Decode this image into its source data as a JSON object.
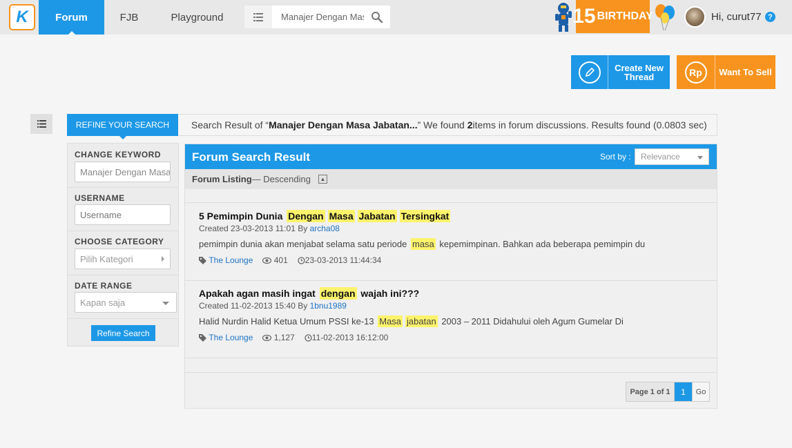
{
  "nav": {
    "logo_text": "K",
    "tabs": [
      {
        "label": "Forum",
        "active": true
      },
      {
        "label": "FJB",
        "active": false
      },
      {
        "label": "Playground",
        "active": false
      }
    ],
    "search": {
      "value": "Manajer Dengan Masa Jabatan"
    },
    "birthday": {
      "number": "15",
      "label": "BIRTHDAY"
    },
    "greeting": "Hi, curut77",
    "help": "?"
  },
  "actions": {
    "create_thread": "Create New Thread",
    "want_to_sell": "Want To Sell",
    "sell_icon_text": "Rp"
  },
  "refine": {
    "tab_label": "REFINE YOUR SEARCH",
    "keyword_label": "CHANGE KEYWORD",
    "keyword_value": "Manajer Dengan Masa Jabatan",
    "username_label": "USERNAME",
    "username_placeholder": "Username",
    "category_label": "CHOOSE CATEGORY",
    "category_value": "Pilih Kategori",
    "date_label": "DATE RANGE",
    "date_value": "Kapan saja",
    "button": "Refine Search"
  },
  "summary": {
    "prefix": "Search Result of “",
    "query": "Manajer Dengan Masa Jabatan...",
    "middle": "” We found ",
    "count": "2",
    "suffix": " items in forum discussions. Results found (0.0803 sec)"
  },
  "results": {
    "title": "Forum Search Result",
    "sort_label": "Sort by :",
    "sort_value": "Relevance",
    "listing_label": "Forum Listing",
    "listing_order": " — Descending",
    "threads": [
      {
        "title_parts": [
          {
            "text": "5 Pemimpin Dunia",
            "hl": false
          },
          {
            "text": "Dengan",
            "hl": true
          },
          {
            "text": "Masa",
            "hl": true
          },
          {
            "text": "Jabatan",
            "hl": true
          },
          {
            "text": "Tersingkat",
            "hl": true
          }
        ],
        "created": "Created 23-03-2013 11:01 By ",
        "author": "archa08",
        "snippet_parts": [
          {
            "text": "pemimpin dunia akan menjabat selama satu periode",
            "hl": false
          },
          {
            "text": "masa",
            "hl": true
          },
          {
            "text": "kepemimpinan. Bahkan ada beberapa pemimpin du",
            "hl": false
          }
        ],
        "category": "The Lounge",
        "views": "401",
        "last_post": "23-03-2013 11:44:34"
      },
      {
        "title_parts": [
          {
            "text": "Apakah agan masih ingat",
            "hl": false
          },
          {
            "text": "dengan",
            "hl": true
          },
          {
            "text": "wajah ini???",
            "hl": false
          }
        ],
        "created": "Created 11-02-2013 15:40 By ",
        "author": "1bnu1989",
        "snippet_parts": [
          {
            "text": "Halid Nurdin Halid Ketua Umum PSSI ke-13",
            "hl": false
          },
          {
            "text": "Masa",
            "hl": true
          },
          {
            "text": "jabatan",
            "hl": true
          },
          {
            "text": "2003 – 2011 Didahului oleh Agum Gumelar Di",
            "hl": false
          }
        ],
        "category": "The Lounge",
        "views": "1,127",
        "last_post": "11-02-2013 16:12:00"
      }
    ],
    "pager": {
      "info": "Page 1 of 1",
      "current": "1",
      "go": "Go"
    }
  },
  "colors": {
    "primary": "#1d98e6",
    "accent": "#f7931e",
    "highlight": "#fcf36b"
  }
}
